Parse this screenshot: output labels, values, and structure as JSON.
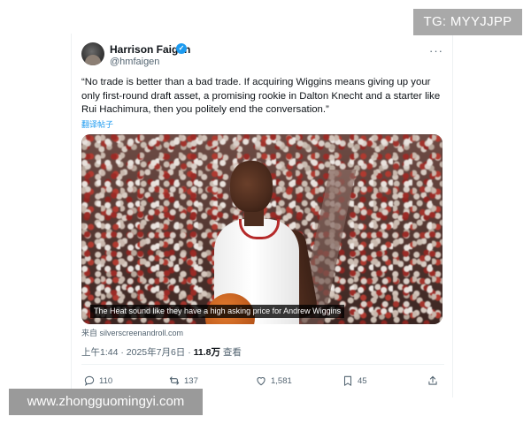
{
  "overlay": {
    "tg_badge": "TG: MYYJJPP",
    "watermark": "www.zhongguomingyi.com"
  },
  "tweet": {
    "author_name": "Harrison Faigen",
    "handle": "@hmfaigen",
    "text": "“No trade is better than a bad trade. If acquiring Wiggins means giving up your only first-round draft asset, a promising rookie in Dalton Knecht and a starter like Rui Hachimura, then you politely end the conversation.”",
    "translate_label": "翻译帖子",
    "media_caption": "The Heat sound like they have a high asking price for Andrew Wiggins",
    "source": "来自 silverscreenandroll.com",
    "time": "上午1:44 · 2025年7月6日 · ",
    "views_count": "11.8万",
    "views_label": " 查看",
    "more_label": "···"
  },
  "actions": {
    "replies": "110",
    "reposts": "137",
    "likes": "1,581",
    "bookmarks": "45"
  },
  "colors": {
    "accent": "#1d9bf0",
    "text": "#0f1419",
    "muted": "#536471"
  }
}
